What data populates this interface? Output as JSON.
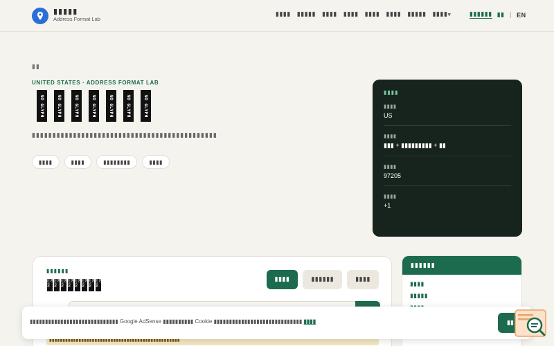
{
  "header": {
    "brand_name": "▮▮▮▮▮",
    "brand_sub": "Address Format Lab",
    "nav": [
      "▮▮▮▮",
      "▮▮▮▮▮",
      "▮▮▮▮",
      "▮▮▮▮",
      "▮▮▮▮",
      "▮▮▮▮",
      "▮▮▮▮▮",
      "▮▮▮▮"
    ],
    "nav_right_active": "▮▮▮▮▮▮",
    "nav_right_2": "▮▮",
    "lang": "EN"
  },
  "hero": {
    "crumb": "▮▮",
    "kicker": "UNITED STATES · ADDRESS FORMAT LAB",
    "title_glyphs": [
      "NO GLYPH",
      "NO GLYPH",
      "NO GLYPH",
      "NO GLYPH",
      "NO GLYPH",
      "NO GLYPH",
      "NO GLYPH"
    ],
    "lead": "▮▮▮▮▮▮▮▮▮▮▮▮▮▮▮▮▮▮▮▮▮▮▮▮▮▮▮▮▮▮▮▮▮▮▮▮▮▮▮▮▮▮▮▮▮",
    "chips": [
      "▮▮▮▮",
      "▮▮▮▮",
      "▮▮▮▮▮▮▮▮",
      "▮▮▮▮"
    ]
  },
  "summary": {
    "title": "▮▮▮▮",
    "rows": [
      {
        "label": "▮▮▮▮",
        "value": "US"
      },
      {
        "label": "▮▮▮▮",
        "value": "▮▮▮ + ▮▮▮▮▮▮▮▮▮ + ▮▮"
      },
      {
        "label": "▮▮▮▮",
        "value": "97205"
      },
      {
        "label": "▮▮▮▮",
        "value": "+1"
      }
    ]
  },
  "tool": {
    "label": "▮▮▮▮▮▮",
    "glyphs": [
      "NO GLYPH",
      "NO GLYPH",
      "NO GLYPH",
      "NO GLYPH",
      "NO GLYPH",
      "NO GLYPH",
      "NO GLYPH",
      "NO GLYPH"
    ],
    "btn_primary": "▮▮▮▮",
    "btn_2": "▮▮▮▮▮▮",
    "btn_3": "▮▮▮▮",
    "strip": "▮▮▮▮▮▮▮▮▮▮▮▮▮▮▮▮▮▮▮▮▮▮▮▮▮▮▮▮▮▮▮▮▮▮▮▮▮▮▮▮▮▮▮▮▮▮▮▮▮"
  },
  "side": {
    "head": "▮▮▮▮▮▮",
    "items": [
      "▮▮▮▮",
      "▮▮▮▮▮",
      "▮▮▮▮",
      "▮▮▮▮▮",
      "▮▮▮▮"
    ]
  },
  "cookie": {
    "text_a": "▮▮▮▮▮▮▮▮▮▮▮▮▮▮▮▮▮▮▮▮▮▮▮▮▮▮▮▮▮",
    "adsense": "Google AdSense",
    "text_b": "▮▮▮▮▮▮▮▮▮▮",
    "cookie_word": "Cookie",
    "text_c": "▮▮▮▮▮▮▮▮▮▮▮▮▮▮▮▮▮▮▮▮▮▮▮▮▮▮▮▮▮",
    "link": "▮▮▮▮",
    "accept": "▮▮"
  },
  "colors": {
    "accent": "#1d6b4e",
    "dark_panel": "#17231d",
    "logo_blue": "#2b6fd6",
    "background": "#f5f3ee"
  },
  "icons": [
    "location-pin-icon",
    "chevron-down-icon",
    "search-document-icon"
  ]
}
